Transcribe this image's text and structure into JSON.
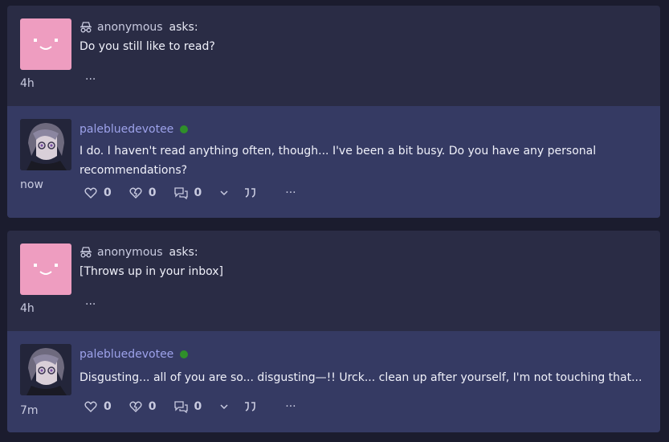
{
  "posts": [
    {
      "ask": {
        "asker_name": "anonymous",
        "asks_label": "asks:",
        "question": "Do you still like to read?",
        "time": "4h",
        "more": "···"
      },
      "answer": {
        "username": "palebluedevotee",
        "text": "I do. I haven't read anything often, though... I've been a bit busy. Do you have any personal recommendations?",
        "time": "now",
        "likes": "0",
        "dislikes": "0",
        "comments": "0",
        "more": "···"
      }
    },
    {
      "ask": {
        "asker_name": "anonymous",
        "asks_label": "asks:",
        "question": "[Throws up in your inbox]",
        "time": "4h",
        "more": "···"
      },
      "answer": {
        "username": "palebluedevotee",
        "text": "Disgusting... all of you are so... disgusting—!! Urck... clean up after yourself, I'm not touching that...",
        "time": "7m",
        "likes": "0",
        "dislikes": "0",
        "comments": "0",
        "more": "···"
      }
    }
  ],
  "colors": {
    "background": "#1b1c2e",
    "card": "#2a2c45",
    "answer_bg": "#353a63",
    "anon_avatar": "#ee9dc0",
    "username": "#9da2ea",
    "online": "#2f8f2a"
  },
  "icons": [
    "incognito-icon",
    "heart-icon",
    "broken-heart-icon",
    "comments-icon",
    "chevron-down-icon",
    "quote-icon",
    "more-icon"
  ]
}
